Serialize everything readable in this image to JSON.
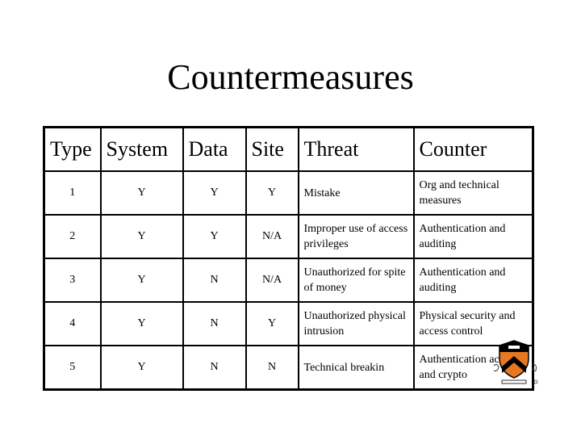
{
  "title": "Countermeasures",
  "table": {
    "headers": [
      "Type",
      "System",
      "Data",
      "Site",
      "Threat",
      "Counter"
    ],
    "rows": [
      {
        "type": "1",
        "system": "Y",
        "data": "Y",
        "site": "Y",
        "threat": "Mistake",
        "counter": "Org and technical measures"
      },
      {
        "type": "2",
        "system": "Y",
        "data": "Y",
        "site": "N/A",
        "threat": "Improper use of access privileges",
        "counter": "Authentication and auditing"
      },
      {
        "type": "3",
        "system": "Y",
        "data": "N",
        "site": "N/A",
        "threat": "Unauthorized for spite of money",
        "counter": "Authentication and auditing"
      },
      {
        "type": "4",
        "system": "Y",
        "data": "N",
        "site": "Y",
        "threat": "Unauthorized physical intrusion",
        "counter": "Physical security and access control"
      },
      {
        "type": "5",
        "system": "Y",
        "data": "N",
        "site": "N",
        "threat": "Technical breakin",
        "counter": "Authentication access and crypto"
      }
    ]
  },
  "logo": {
    "name": "university-shield-logo",
    "colors": {
      "orange": "#e87722",
      "black": "#000000"
    }
  }
}
